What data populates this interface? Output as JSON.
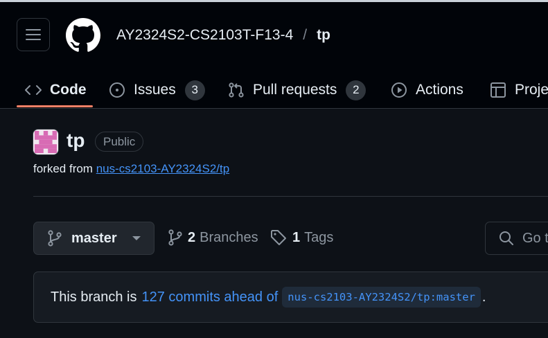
{
  "header": {
    "owner": "AY2324S2-CS2103T-F13-4",
    "separator": "/",
    "repo": "tp",
    "icons": {
      "menu": "hamburger-icon",
      "logo": "github-logo"
    }
  },
  "tabs": [
    {
      "label": "Code",
      "icon": "code-icon",
      "count": null
    },
    {
      "label": "Issues",
      "icon": "issue-icon",
      "count": "3"
    },
    {
      "label": "Pull requests",
      "icon": "pull-request-icon",
      "count": "2"
    },
    {
      "label": "Actions",
      "icon": "play-icon",
      "count": null
    },
    {
      "label": "Proje",
      "icon": "table-icon",
      "count": null
    }
  ],
  "repo": {
    "name": "tp",
    "visibility": "Public",
    "forked_prefix": "forked from",
    "forked_source": "nus-cs2103-AY2324S2/tp"
  },
  "toolbar": {
    "branch": "master",
    "branches_count": "2",
    "branches_label": "Branches",
    "tags_count": "1",
    "tags_label": "Tags",
    "goto_placeholder": "Go t"
  },
  "ahead": {
    "prefix": "This branch is",
    "link": "127 commits ahead of",
    "ref": "nus-cs2103-AY2324S2/tp:master",
    "suffix": "."
  },
  "colors": {
    "header_bg": "#010409",
    "page_bg": "#0d1117",
    "link": "#4493f8",
    "tab_underline": "#f78166",
    "border": "#30363d"
  }
}
